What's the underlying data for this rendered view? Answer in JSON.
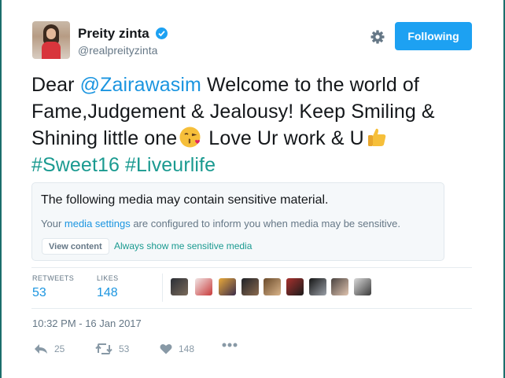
{
  "profile": {
    "name": "Preity zinta",
    "handle": "@realpreityzinta",
    "verified": true
  },
  "follow_button_label": "Following",
  "tweet": {
    "part1": "Dear ",
    "mention": "@Zairawasim",
    "part2": " Welcome to the world of Fame,Judgement & Jealousy! Keep Smiling & Shining little one",
    "emoji1": "face-throwing-kiss-emoji",
    "part3": " Love Ur work & U",
    "emoji2": "thumbs-up-emoji",
    "hashtag1": "#Sweet16",
    "hashtag2": "#Liveurlife"
  },
  "sensitive": {
    "title": "The following media may contain sensitive material.",
    "body_prefix": "Your ",
    "body_link": "media settings",
    "body_suffix": " are configured to inform you when media may be sensitive.",
    "view_button": "View content",
    "always_show_link": "Always show me sensitive media"
  },
  "stats": {
    "retweets_label": "RETWEETS",
    "retweets_value": "53",
    "likes_label": "LIKES",
    "likes_value": "148"
  },
  "likers_count": 9,
  "timestamp": "10:32 PM - 16 Jan 2017",
  "actions": {
    "reply_count": "25",
    "retweet_count": "53",
    "like_count": "148"
  },
  "colors": {
    "accent": "#1da1f2",
    "link": "#1b95e0",
    "hashtag": "#1a9a90",
    "muted": "#657786",
    "frame": "#1b6e6c"
  }
}
